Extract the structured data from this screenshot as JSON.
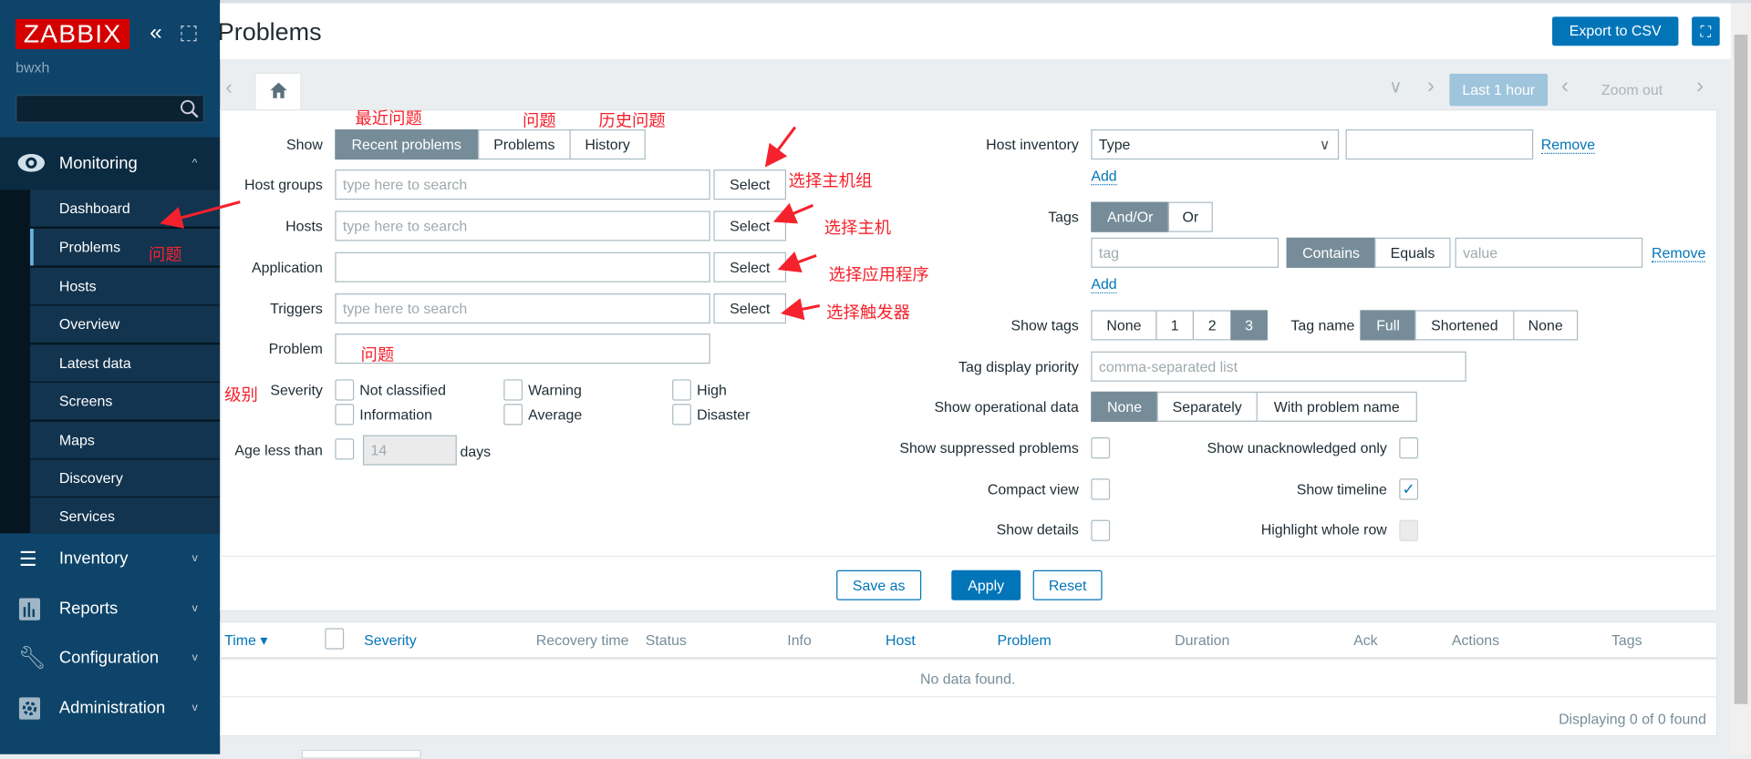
{
  "sidebar": {
    "logo": "ZABBIX",
    "username": "bwxh",
    "search_placeholder": "",
    "sections": [
      {
        "label": "Monitoring",
        "icon": "eye-icon",
        "expanded": true
      },
      {
        "label": "Inventory",
        "icon": "list-icon"
      },
      {
        "label": "Reports",
        "icon": "bar-chart-icon"
      },
      {
        "label": "Configuration",
        "icon": "wrench-icon"
      },
      {
        "label": "Administration",
        "icon": "gear-icon"
      }
    ],
    "monitoring_items": [
      "Dashboard",
      "Problems",
      "Hosts",
      "Overview",
      "Latest data",
      "Screens",
      "Maps",
      "Discovery",
      "Services"
    ],
    "active_item": "Problems"
  },
  "header": {
    "title": "Problems",
    "export_label": "Export to CSV"
  },
  "timebar": {
    "range_label": "Last 1 hour",
    "zoom_out_label": "Zoom out"
  },
  "filter": {
    "show": {
      "label": "Show",
      "options": [
        "Recent problems",
        "Problems",
        "History"
      ],
      "selected": "Recent problems"
    },
    "host_groups": {
      "label": "Host groups",
      "placeholder": "type here to search",
      "button": "Select"
    },
    "hosts": {
      "label": "Hosts",
      "placeholder": "type here to search",
      "button": "Select"
    },
    "application": {
      "label": "Application",
      "value": "",
      "button": "Select"
    },
    "triggers": {
      "label": "Triggers",
      "placeholder": "type here to search",
      "button": "Select"
    },
    "problem": {
      "label": "Problem",
      "value": ""
    },
    "severity": {
      "label": "Severity",
      "options": [
        "Not classified",
        "Warning",
        "High",
        "Information",
        "Average",
        "Disaster"
      ]
    },
    "age": {
      "label": "Age less than",
      "value": "14",
      "unit": "days"
    },
    "host_inventory": {
      "label": "Host inventory",
      "select": "Type",
      "value": "",
      "remove": "Remove",
      "add": "Add"
    },
    "tags": {
      "label": "Tags",
      "operators": [
        "And/Or",
        "Or"
      ],
      "selected_operator": "And/Or",
      "tag_placeholder": "tag",
      "match": [
        "Contains",
        "Equals"
      ],
      "selected_match": "Contains",
      "value_placeholder": "value",
      "remove": "Remove",
      "add": "Add"
    },
    "show_tags": {
      "label": "Show tags",
      "options": [
        "None",
        "1",
        "2",
        "3"
      ],
      "selected": "3"
    },
    "tag_name": {
      "label": "Tag name",
      "options": [
        "Full",
        "Shortened",
        "None"
      ],
      "selected": "Full"
    },
    "tag_display_priority": {
      "label": "Tag display priority",
      "placeholder": "comma-separated list"
    },
    "operational_data": {
      "label": "Show operational data",
      "options": [
        "None",
        "Separately",
        "With problem name"
      ],
      "selected": "None"
    },
    "checks": {
      "suppressed": {
        "label": "Show suppressed problems",
        "checked": false
      },
      "unack": {
        "label": "Show unacknowledged only",
        "checked": false
      },
      "compact": {
        "label": "Compact view",
        "checked": false
      },
      "timeline": {
        "label": "Show timeline",
        "checked": true
      },
      "details": {
        "label": "Show details",
        "checked": false
      },
      "highlight": {
        "label": "Highlight whole row",
        "checked": false,
        "disabled": true
      }
    },
    "buttons": {
      "save_as": "Save as",
      "apply": "Apply",
      "reset": "Reset"
    }
  },
  "table": {
    "columns": [
      "Time ▾",
      "Severity",
      "Recovery time",
      "Status",
      "Info",
      "Host",
      "Problem",
      "Duration",
      "Ack",
      "Actions",
      "Tags"
    ],
    "empty": "No data found.",
    "footer": "Displaying 0 of 0 found"
  },
  "annotations": {
    "recent": "最近问题",
    "problems": "问题",
    "history": "历史问题",
    "host_groups": "选择主机组",
    "hosts": "选择主机",
    "application": "选择应用程序",
    "triggers": "选择触发器",
    "sidebar_problems": "问题",
    "problem_field": "问题",
    "severity": "级别"
  },
  "colors": {
    "accent": "#0275b8",
    "sidebar": "#0e4469",
    "selected_segment": "#768d99",
    "annotation": "#f5222d",
    "logo": "#d40000"
  }
}
